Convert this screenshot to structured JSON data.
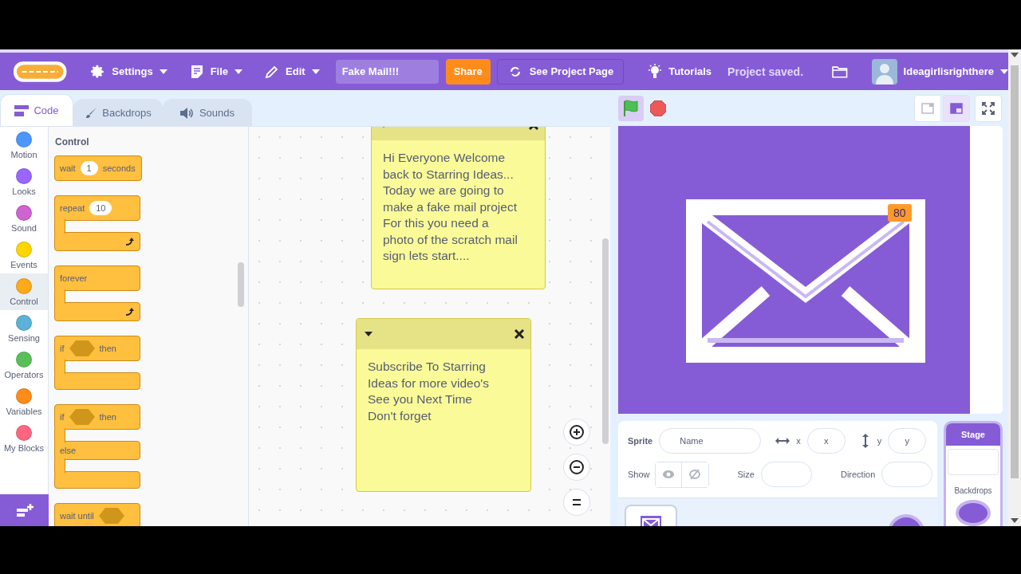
{
  "menu_bar": {
    "menus": [
      {
        "label": "Settings",
        "kind": "gear"
      },
      {
        "label": "File",
        "kind": "file"
      },
      {
        "label": "Edit",
        "kind": "pencil"
      }
    ],
    "project_title": "Fake Mail!!!",
    "share": "Share",
    "see_project_page": "See Project Page",
    "tutorials": "Tutorials",
    "status": "Project saved.",
    "username": "Ideagirlisrighthere"
  },
  "editor_tabs": [
    {
      "label": "Code",
      "kind": "code",
      "selected": true
    },
    {
      "label": "Backdrops",
      "kind": "brush",
      "selected": false
    },
    {
      "label": "Sounds",
      "kind": "speaker",
      "selected": false
    }
  ],
  "categories": [
    {
      "label": "Motion",
      "color": "#4c97ff",
      "selected": false
    },
    {
      "label": "Looks",
      "color": "#9966ff",
      "selected": false
    },
    {
      "label": "Sound",
      "color": "#cf63cf",
      "selected": false
    },
    {
      "label": "Events",
      "color": "#ffd500",
      "selected": false
    },
    {
      "label": "Control",
      "color": "#ffab19",
      "selected": true
    },
    {
      "label": "Sensing",
      "color": "#5cb1d6",
      "selected": false
    },
    {
      "label": "Operators",
      "color": "#59c059",
      "selected": false
    },
    {
      "label": "Variables",
      "color": "#ff8c1a",
      "selected": false
    },
    {
      "label": "My Blocks",
      "color": "#ff6680",
      "selected": false
    }
  ],
  "palette": {
    "title": "Control",
    "blocks": [
      {
        "kind": "command",
        "words": [
          {
            "kind": "text",
            "text": "wait"
          },
          {
            "kind": "number",
            "text": "1"
          },
          {
            "kind": "text",
            "text": "seconds"
          }
        ]
      },
      {
        "kind": "loop",
        "words": [
          {
            "kind": "text",
            "text": "repeat"
          },
          {
            "kind": "number",
            "text": "10"
          }
        ]
      },
      {
        "kind": "loop",
        "words": [
          {
            "kind": "text",
            "text": "forever"
          }
        ]
      },
      {
        "kind": "if",
        "words": [
          {
            "kind": "text",
            "text": "if"
          },
          {
            "kind": "boolean"
          },
          {
            "kind": "text",
            "text": "then"
          }
        ]
      },
      {
        "kind": "if_else",
        "words": [
          {
            "kind": "text",
            "text": "if"
          },
          {
            "kind": "boolean"
          },
          {
            "kind": "text",
            "text": "then"
          }
        ],
        "else": "else"
      },
      {
        "kind": "command",
        "words": [
          {
            "kind": "text",
            "text": "wait until"
          },
          {
            "kind": "boolean"
          }
        ]
      }
    ]
  },
  "notes": [
    {
      "text": "Hi Everyone Welcome\nback to Starring Ideas...\nToday we are going to\nmake a fake mail project\nFor this you need a\nphoto of the scratch mail\nsign lets start...."
    },
    {
      "text": "Subscribe To Starring\nIdeas for more video's\nSee you Next Time\nDon't forget "
    }
  ],
  "stage_header": {
    "green_flag_active": true,
    "layout_modes": [
      {
        "kind": "small",
        "selected": false
      },
      {
        "kind": "normal",
        "selected": true
      }
    ]
  },
  "stage": {
    "badge": "80"
  },
  "sprite_info": {
    "sprite_label": "Sprite",
    "name_placeholder": "Name",
    "x_label": "x",
    "x_placeholder": "x",
    "y_label": "y",
    "y_placeholder": "y",
    "show_label": "Show",
    "size_label": "Size",
    "direction_label": "Direction"
  },
  "stage_selector": {
    "title": "Stage",
    "backdrops_label": "Backdrops"
  }
}
